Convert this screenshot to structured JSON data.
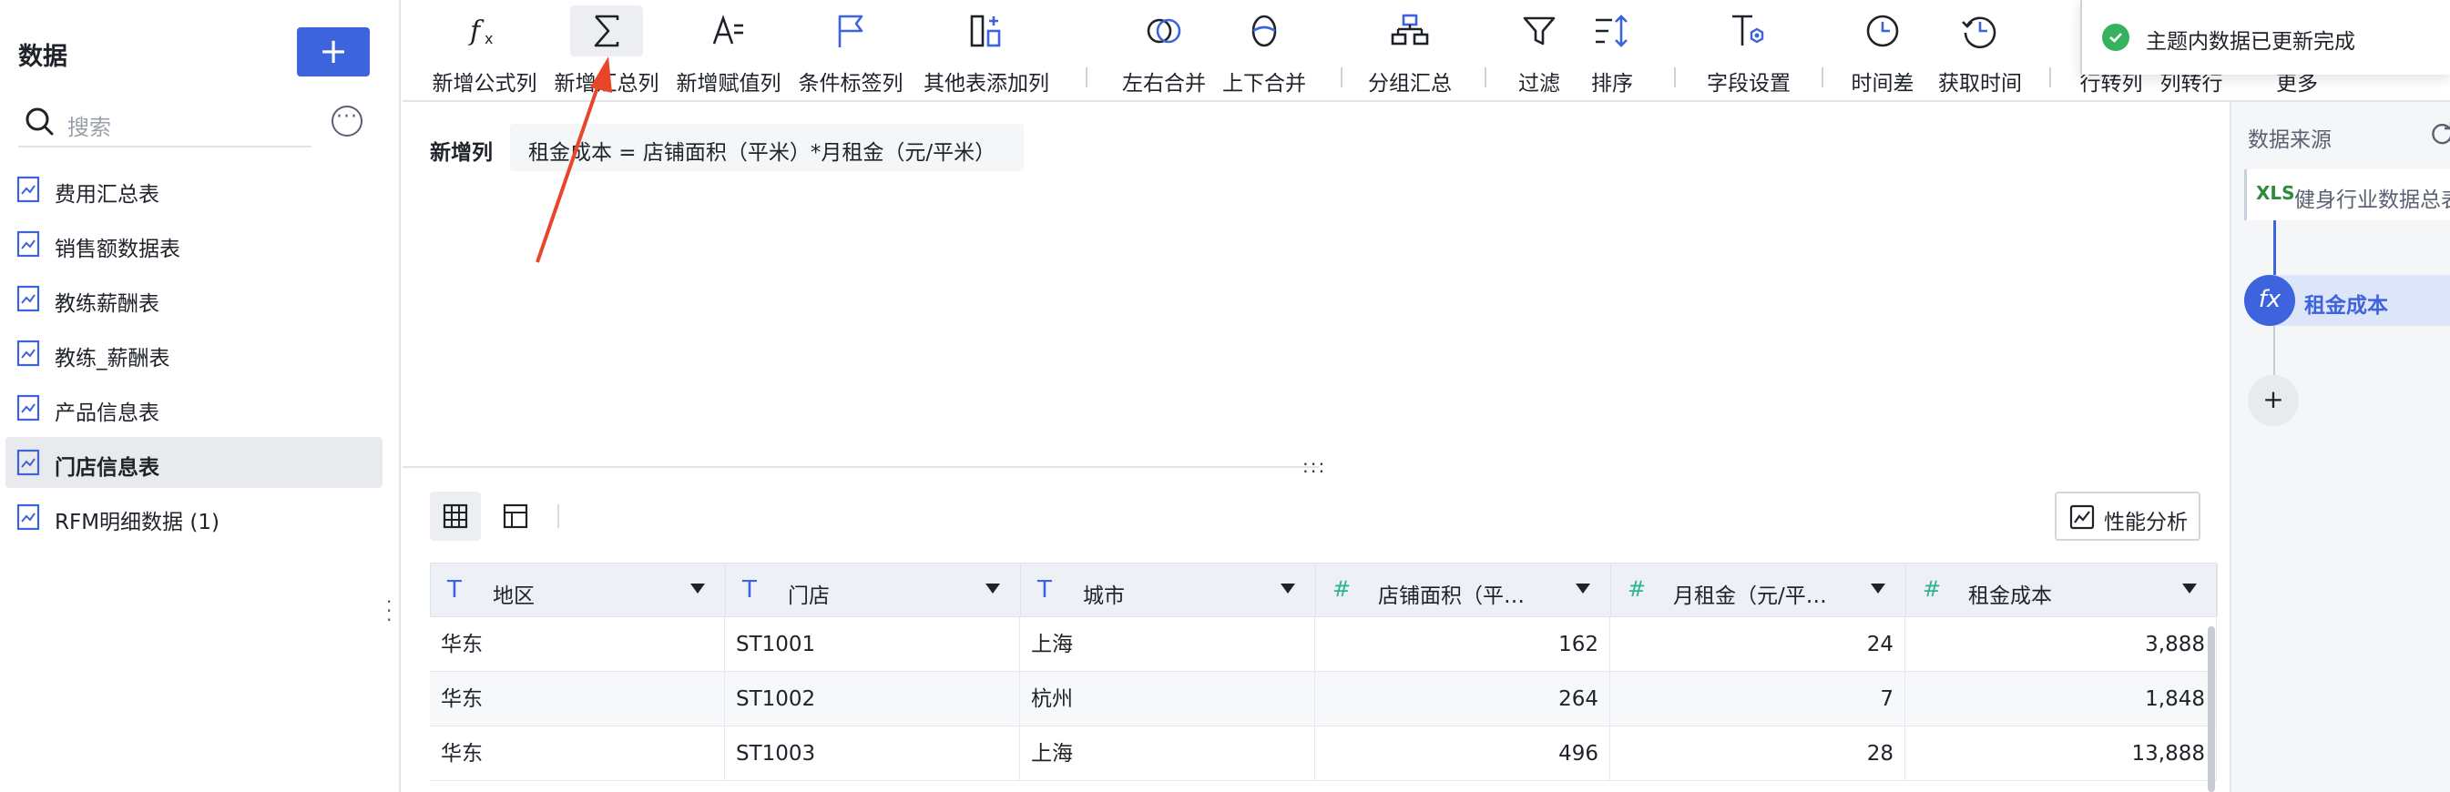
{
  "sidebar": {
    "title": "数据",
    "add_label": "+",
    "search_placeholder": "搜索",
    "items": [
      {
        "label": "费用汇总表",
        "active": false
      },
      {
        "label": "销售额数据表",
        "active": false
      },
      {
        "label": "教练薪酬表",
        "active": false
      },
      {
        "label": "教练_薪酬表",
        "active": false
      },
      {
        "label": "产品信息表",
        "active": false
      },
      {
        "label": "门店信息表",
        "active": true
      },
      {
        "label": "RFM明细数据 (1)",
        "active": false
      }
    ]
  },
  "toolbar": {
    "items": [
      {
        "label": "新增公式列",
        "icon": "fx-icon"
      },
      {
        "label": "新增汇总列",
        "icon": "sigma-icon",
        "highlighted": true
      },
      {
        "label": "新增赋值列",
        "icon": "assign-icon"
      },
      {
        "label": "条件标签列",
        "icon": "flag-icon"
      },
      {
        "label": "其他表添加列",
        "icon": "add-column-icon"
      },
      {
        "label": "左右合并",
        "icon": "merge-horizontal-icon"
      },
      {
        "label": "上下合并",
        "icon": "merge-vertical-icon"
      },
      {
        "label": "分组汇总",
        "icon": "group-icon"
      },
      {
        "label": "过滤",
        "icon": "filter-icon"
      },
      {
        "label": "排序",
        "icon": "sort-icon"
      },
      {
        "label": "字段设置",
        "icon": "field-settings-icon"
      },
      {
        "label": "时间差",
        "icon": "time-diff-icon"
      },
      {
        "label": "获取时间",
        "icon": "get-time-icon"
      },
      {
        "label": "行转列",
        "icon": ""
      },
      {
        "label": "列转行",
        "icon": ""
      },
      {
        "label": "更多",
        "icon": ""
      }
    ]
  },
  "formula": {
    "label": "新增列",
    "expression": "租金成本 = 店铺面积（平米）*月租金（元/平米）"
  },
  "perf_button": "性能分析",
  "table": {
    "columns": [
      {
        "type": "T",
        "name": "地区",
        "align": "left"
      },
      {
        "type": "T",
        "name": "门店",
        "align": "left"
      },
      {
        "type": "T",
        "name": "城市",
        "align": "left"
      },
      {
        "type": "#",
        "name": "店铺面积（平…",
        "align": "right"
      },
      {
        "type": "#",
        "name": "月租金（元/平…",
        "align": "right"
      },
      {
        "type": "#",
        "name": "租金成本",
        "align": "right"
      }
    ],
    "rows": [
      [
        "华东",
        "ST1001",
        "上海",
        "162",
        "24",
        "3,888"
      ],
      [
        "华东",
        "ST1002",
        "杭州",
        "264",
        "7",
        "1,848"
      ],
      [
        "华东",
        "ST1003",
        "上海",
        "496",
        "28",
        "13,888"
      ]
    ]
  },
  "lineage": {
    "title": "数据来源",
    "source_badge": "XLS",
    "source_name": "健身行业数据总表",
    "node_icon": "fx",
    "node_name": "租金成本",
    "add_label": "+"
  },
  "toast": {
    "message": "主题内数据已更新完成",
    "status_color": "#34b25d"
  },
  "colors": {
    "accent": "#3d63dd",
    "annotation_arrow": "#e8462a"
  }
}
